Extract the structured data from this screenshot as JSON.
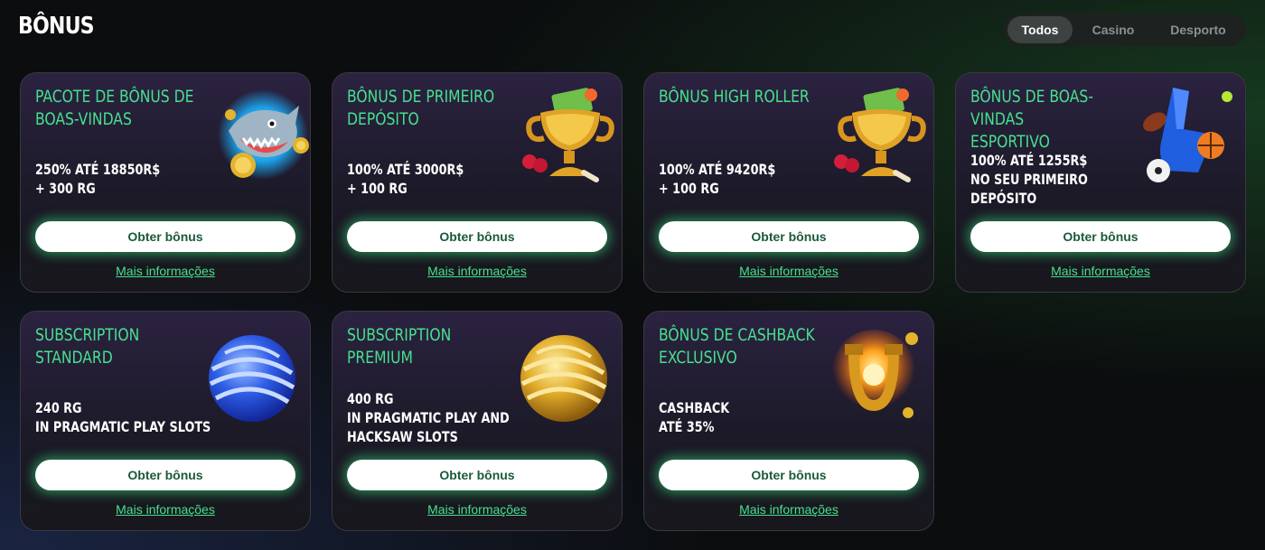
{
  "page": {
    "title": "BÔNUS"
  },
  "tabs": [
    {
      "label": "Todos",
      "active": true
    },
    {
      "label": "Casino",
      "active": false
    },
    {
      "label": "Desporto",
      "active": false
    }
  ],
  "cards": [
    {
      "title_lines": [
        "PACOTE DE BÔNUS DE",
        "BOAS-VINDAS"
      ],
      "desc_lines": [
        "250% ATÉ 18850R$",
        "+ 300 RG"
      ],
      "button": "Obter bônus",
      "link": "Mais informações",
      "art": "shark-icon"
    },
    {
      "title_lines": [
        "BÔNUS DE PRIMEIRO",
        "DEPÓSITO"
      ],
      "desc_lines": [
        "100% ATÉ 3000R$",
        "+ 100 RG"
      ],
      "button": "Obter bônus",
      "link": "Mais informações",
      "art": "trophy-icon"
    },
    {
      "title_lines": [
        "BÔNUS HIGH ROLLER"
      ],
      "desc_lines": [
        "100% ATÉ 9420R$",
        "+ 100 RG"
      ],
      "button": "Obter bônus",
      "link": "Mais informações",
      "art": "trophy-icon"
    },
    {
      "title_lines": [
        "BÔNUS DE BOAS-VINDAS",
        "ESPORTIVO"
      ],
      "desc_lines": [
        "100% ATÉ 1255R$",
        "NO SEU PRIMEIRO",
        "DEPÓSITO"
      ],
      "button": "Obter bônus",
      "link": "Mais informações",
      "art": "foam-finger-icon"
    },
    {
      "title_lines": [
        "SUBSCRIPTION STANDARD"
      ],
      "desc_lines": [
        "240 RG",
        "IN PRAGMATIC PLAY SLOTS"
      ],
      "button": "Obter bônus",
      "link": "Mais informações",
      "art": "blue-sphere-icon"
    },
    {
      "title_lines": [
        "SUBSCRIPTION PREMIUM"
      ],
      "desc_lines": [
        "400 RG",
        "IN PRAGMATIC PLAY AND",
        "HACKSAW SLOTS"
      ],
      "button": "Obter bônus",
      "link": "Mais informações",
      "art": "gold-sphere-icon"
    },
    {
      "title_lines": [
        "BÔNUS DE CASHBACK",
        "EXCLUSIVO"
      ],
      "desc_lines": [
        "CASHBACK",
        "ATÉ 35%"
      ],
      "button": "Obter bônus",
      "link": "Mais informações",
      "art": "horseshoe-icon"
    }
  ],
  "colors": {
    "accent": "#46e08e",
    "background": "#0b0d0e",
    "card": "#1c1a28",
    "button_text": "#1a5a3a"
  }
}
